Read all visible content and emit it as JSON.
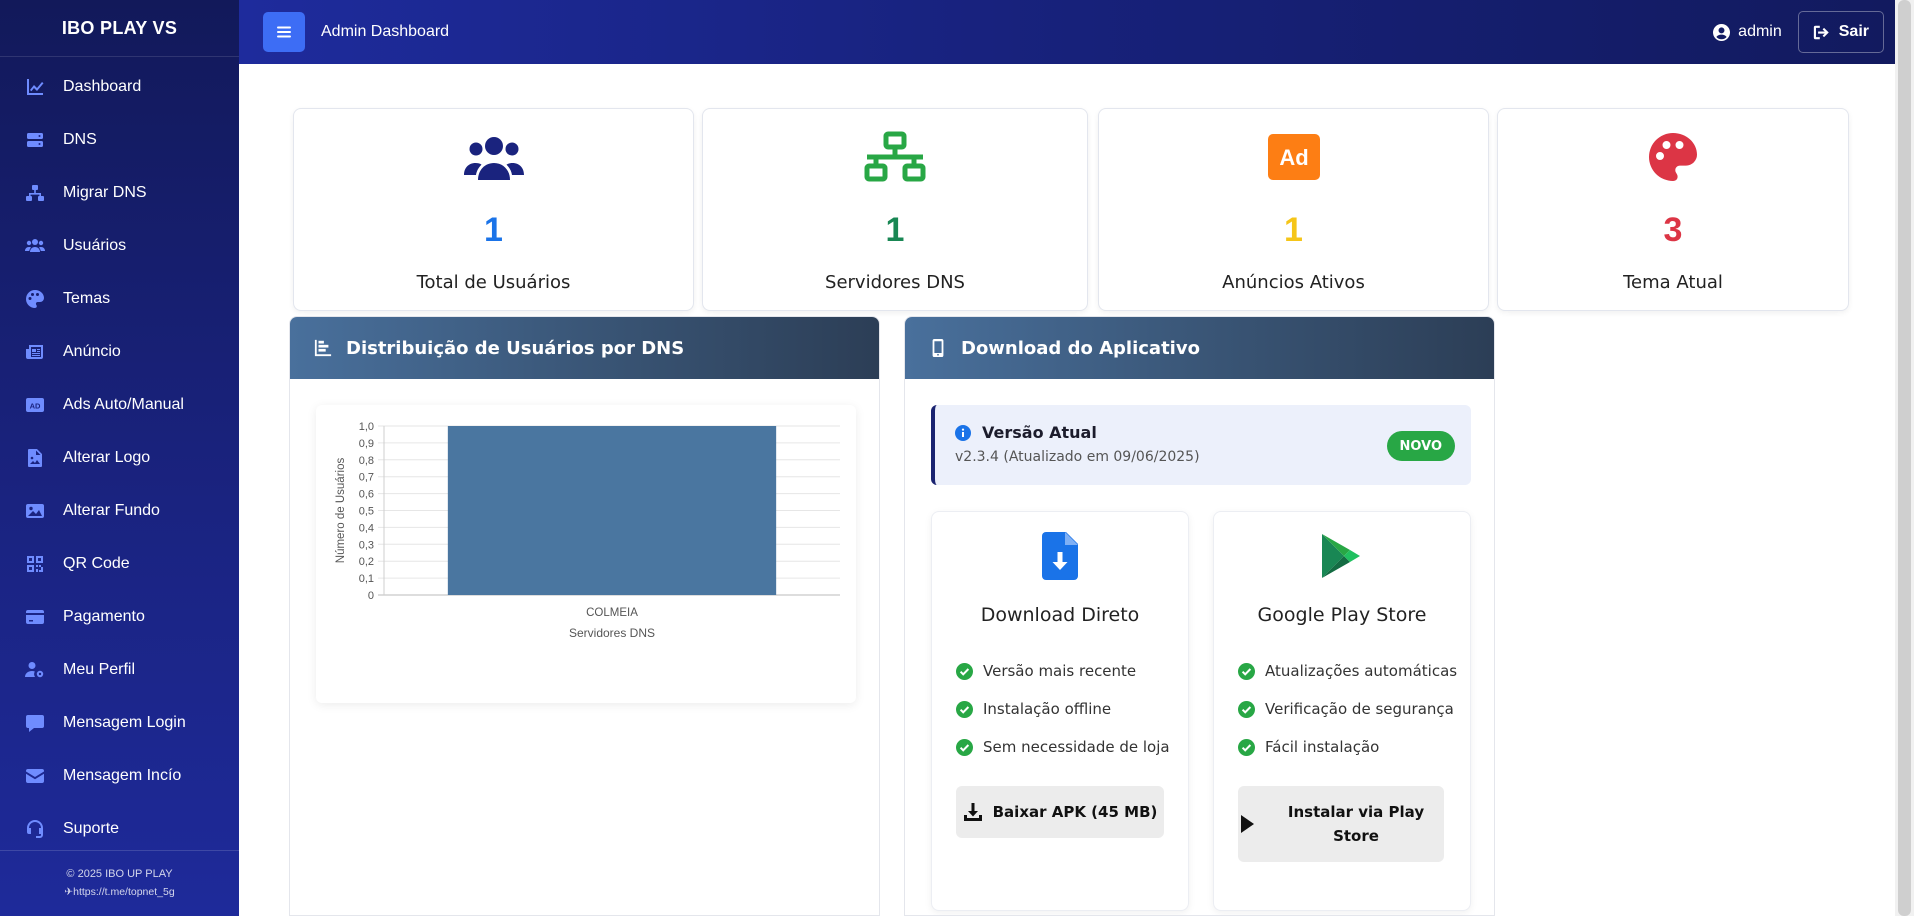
{
  "sidebar": {
    "brand": "IBO PLAY VS",
    "items": [
      {
        "label": "Dashboard",
        "icon": "chart-line-icon"
      },
      {
        "label": "DNS",
        "icon": "server-icon"
      },
      {
        "label": "Migrar DNS",
        "icon": "network-icon"
      },
      {
        "label": "Usuários",
        "icon": "users-icon"
      },
      {
        "label": "Temas",
        "icon": "palette-icon"
      },
      {
        "label": "Anúncio",
        "icon": "newspaper-icon"
      },
      {
        "label": "Ads Auto/Manual",
        "icon": "ad-icon"
      },
      {
        "label": "Alterar Logo",
        "icon": "file-image-icon"
      },
      {
        "label": "Alterar Fundo",
        "icon": "image-icon"
      },
      {
        "label": "QR Code",
        "icon": "qrcode-icon"
      },
      {
        "label": "Pagamento",
        "icon": "credit-card-icon"
      },
      {
        "label": "Meu Perfil",
        "icon": "user-cog-icon"
      },
      {
        "label": "Mensagem Login",
        "icon": "comment-icon"
      },
      {
        "label": "Mensagem Incío",
        "icon": "envelope-icon"
      },
      {
        "label": "Suporte",
        "icon": "headset-icon"
      }
    ],
    "footer_copyright": "© 2025 IBO UP PLAY",
    "footer_link": "https://t.me/topnet_5g"
  },
  "topbar": {
    "title": "Admin Dashboard",
    "user": "admin",
    "logout_label": "Sair"
  },
  "stats": [
    {
      "value": "1",
      "label": "Total de Usuários",
      "icon": "users-icon",
      "color": "#1a73e8",
      "icon_color": "#1a237e"
    },
    {
      "value": "1",
      "label": "Servidores DNS",
      "icon": "network-icon",
      "color": "#198754",
      "icon_color": "#28a745"
    },
    {
      "value": "1",
      "label": "Anúncios Ativos",
      "icon": "ad-icon",
      "color": "#f5c518",
      "icon_color": "#fd7e14"
    },
    {
      "value": "3",
      "label": "Tema Atual",
      "icon": "palette-icon",
      "color": "#dc3545",
      "icon_color": "#dc3545"
    }
  ],
  "chart_panel": {
    "title": "Distribuição de Usuários por DNS"
  },
  "chart_data": {
    "type": "bar",
    "categories": [
      "COLMEIA"
    ],
    "values": [
      1
    ],
    "xlabel": "Servidores DNS",
    "ylabel": "Número de Usuários",
    "ylim": [
      0,
      1
    ],
    "ytick_labels": [
      "0",
      "0,1",
      "0,2",
      "0,3",
      "0,4",
      "0,5",
      "0,6",
      "0,7",
      "0,8",
      "0,9",
      "1,0"
    ],
    "color": "#4a76a0",
    "grid": true,
    "legend": "none"
  },
  "download_panel": {
    "title": "Download do Aplicativo",
    "version_title": "Versão Atual",
    "version_subtitle": "v2.3.4 (Atualizado em 09/06/2025)",
    "badge": "NOVO",
    "cards": [
      {
        "title": "Download Direto",
        "icon": "file-download-icon",
        "features": [
          "Versão mais recente",
          "Instalação offline",
          "Sem necessidade de loja"
        ],
        "button": "Baixar APK (45 MB)"
      },
      {
        "title": "Google Play Store",
        "icon": "google-play-icon",
        "features": [
          "Atualizações automáticas",
          "Verificação de segurança",
          "Fácil instalação"
        ],
        "button": "Instalar via Play Store"
      }
    ]
  }
}
